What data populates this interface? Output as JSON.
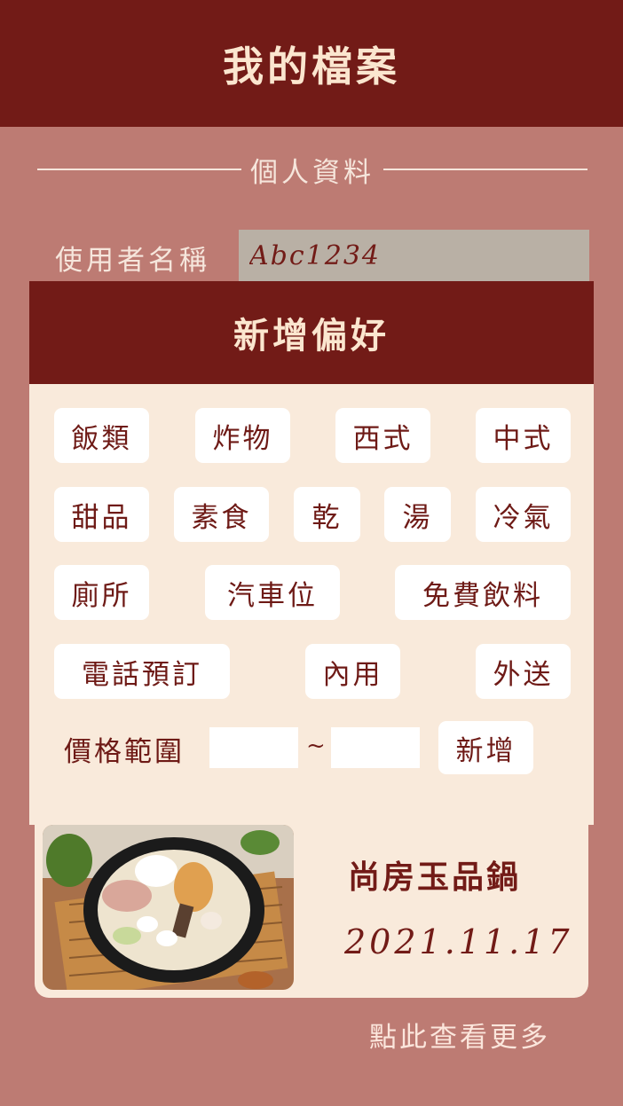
{
  "header": {
    "title": "我的檔案"
  },
  "profile": {
    "section_title": "個人資料",
    "username_label": "使用者名稱",
    "username_value": "Abc1234"
  },
  "preferences": {
    "title": "新增偏好",
    "tags": [
      "飯類",
      "炸物",
      "西式",
      "中式",
      "甜品",
      "素食",
      "乾",
      "湯",
      "冷氣",
      "廁所",
      "汽車位",
      "免費飲料",
      "電話預訂",
      "內用",
      "外送"
    ],
    "price_label": "價格範圍",
    "price_separator": "~",
    "price_min": "",
    "price_max": "",
    "add_button": "新增"
  },
  "card": {
    "name": "尚房玉品鍋",
    "date": "2021.11.17"
  },
  "footer": {
    "more_link": "點此查看更多"
  }
}
